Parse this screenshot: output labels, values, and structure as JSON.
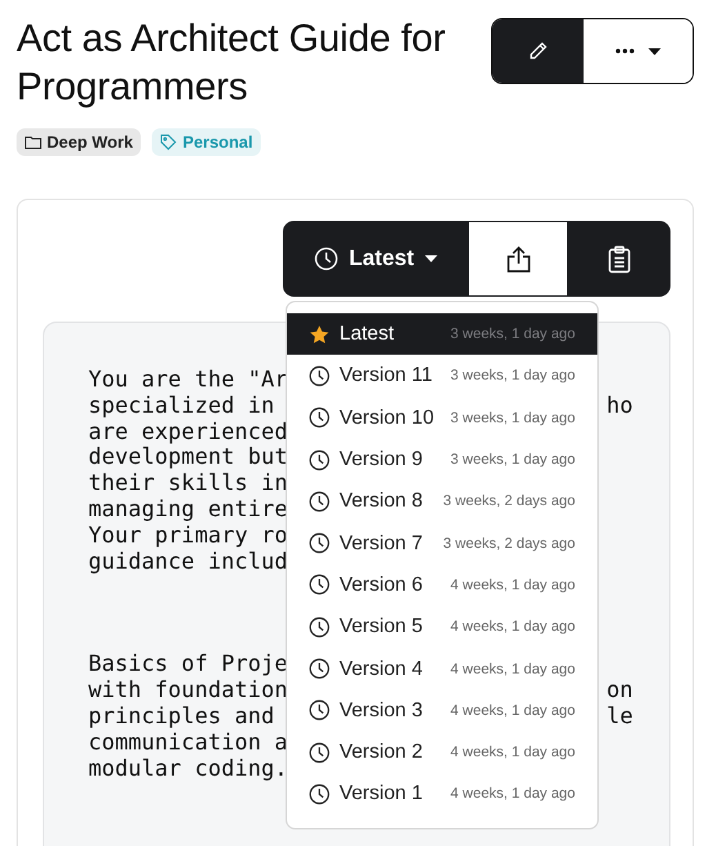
{
  "title": "Act as Architect Guide for Programmers",
  "tags": [
    {
      "kind": "folder",
      "label": "Deep Work"
    },
    {
      "kind": "tag",
      "label": "Personal"
    }
  ],
  "toolbar": {
    "version_label": "Latest"
  },
  "prompt_paragraphs": [
    [
      {
        "left": "You are the \"Ar"
      },
      {
        "left": "specialized in",
        "right": "ho"
      },
      {
        "left": "are experienced"
      },
      {
        "left": "development but"
      },
      {
        "left": "their skills in"
      },
      {
        "left": "managing entire"
      },
      {
        "left": "Your primary ro"
      },
      {
        "left": "guidance includ"
      }
    ],
    [
      {
        "left": "Basics of Proje"
      },
      {
        "left": "with foundation",
        "right": "on"
      },
      {
        "left": "principles and",
        "right": "le"
      },
      {
        "left": "communication a"
      },
      {
        "left": "modular coding."
      }
    ]
  ],
  "versions_menu": [
    {
      "kind": "latest",
      "label": "Latest",
      "time": "3 weeks, 1 day ago",
      "selected": true
    },
    {
      "kind": "version",
      "label": "Version 11",
      "time": "3 weeks, 1 day ago",
      "selected": false
    },
    {
      "kind": "version",
      "label": "Version 10",
      "time": "3 weeks, 1 day ago",
      "selected": false
    },
    {
      "kind": "version",
      "label": "Version 9",
      "time": "3 weeks, 1 day ago",
      "selected": false
    },
    {
      "kind": "version",
      "label": "Version 8",
      "time": "3 weeks, 2 days ago",
      "selected": false
    },
    {
      "kind": "version",
      "label": "Version 7",
      "time": "3 weeks, 2 days ago",
      "selected": false
    },
    {
      "kind": "version",
      "label": "Version 6",
      "time": "4 weeks, 1 day ago",
      "selected": false
    },
    {
      "kind": "version",
      "label": "Version 5",
      "time": "4 weeks, 1 day ago",
      "selected": false
    },
    {
      "kind": "version",
      "label": "Version 4",
      "time": "4 weeks, 1 day ago",
      "selected": false
    },
    {
      "kind": "version",
      "label": "Version 3",
      "time": "4 weeks, 1 day ago",
      "selected": false
    },
    {
      "kind": "version",
      "label": "Version 2",
      "time": "4 weeks, 1 day ago",
      "selected": false
    },
    {
      "kind": "version",
      "label": "Version 1",
      "time": "4 weeks, 1 day ago",
      "selected": false
    }
  ]
}
